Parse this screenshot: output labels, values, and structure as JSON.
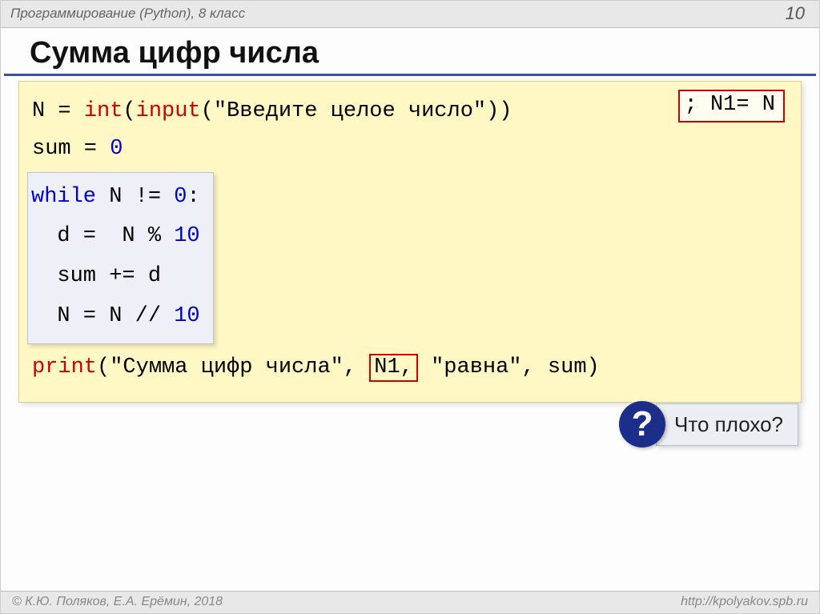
{
  "header": {
    "course": "Программирование (Python), 8 класс",
    "page_number": "10"
  },
  "title": "Сумма цифр числа",
  "code": {
    "line1": {
      "var": "N = ",
      "int": "int",
      "open": "(",
      "input": "input",
      "args": "(\"Введите целое число\"))"
    },
    "n1_top": "; N1= N",
    "line2": {
      "text": "sum = ",
      "zero": "0"
    },
    "inner": {
      "l1": {
        "wh": "while",
        "rest": " N != ",
        "zero": "0",
        "colon": ":"
      },
      "l2": {
        "pre": "  d =  N % ",
        "ten": "10"
      },
      "l3": "  sum += d",
      "l4": {
        "pre": "  N = N // ",
        "ten": "10"
      }
    },
    "line_print": {
      "print": "print",
      "open": "(",
      "s1": "\"Сумма цифр числа\"",
      "comma1": ", ",
      "n1": "N1,",
      "s2": " \"равна\"",
      "rest": ", sum)"
    }
  },
  "question": {
    "mark": "?",
    "text": "Что плохо?"
  },
  "footer": {
    "left": "© К.Ю. Поляков, Е.А. Ерёмин, 2018",
    "right": "http://kpolyakov.spb.ru"
  }
}
